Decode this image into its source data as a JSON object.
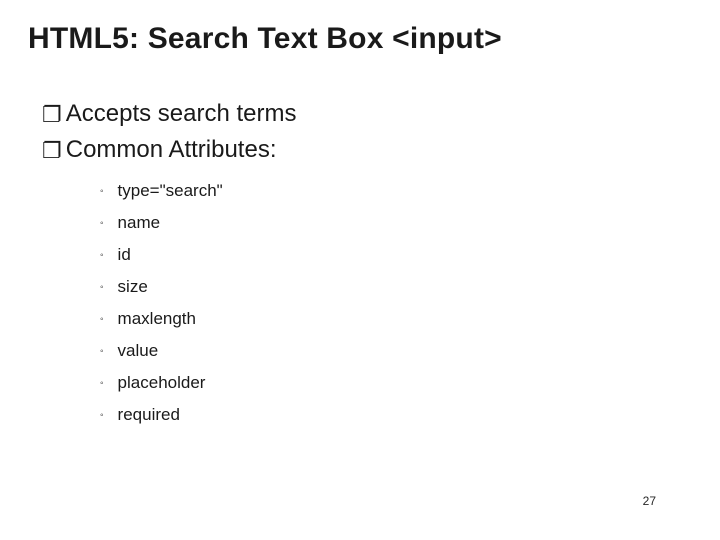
{
  "title": "HTML5: Search Text Box <input>",
  "bullets": [
    {
      "text": "Accepts search  terms"
    },
    {
      "text": "Common Attributes:"
    }
  ],
  "sub_bullets": [
    "type=\"search\"",
    "name",
    "id",
    "size",
    "maxlength",
    "value",
    "placeholder",
    "required"
  ],
  "page_number": "27"
}
